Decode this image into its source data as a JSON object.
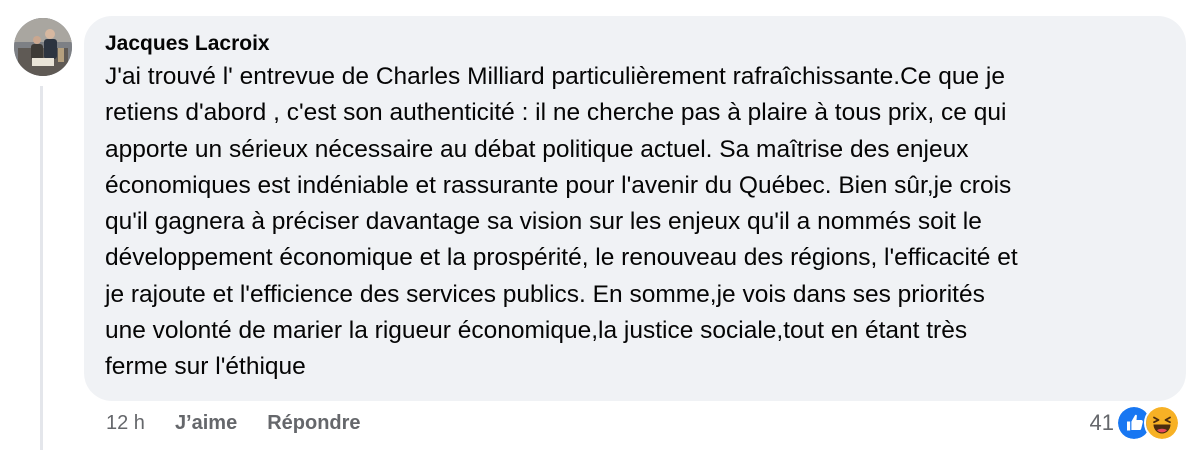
{
  "comment": {
    "author": "Jacques Lacroix",
    "text": "J'ai trouvé l' entrevue de Charles Milliard particulièrement rafraîchissante.Ce que je retiens d'abord , c'est son authenticité : il ne cherche pas à plaire à tous prix, ce qui apporte un sérieux nécessaire au débat politique actuel. Sa maîtrise des enjeux économiques est indéniable et rassurante pour l'avenir du Québec. Bien sûr,je crois qu'il gagnera à préciser davantage sa vision sur les enjeux qu'il a nommés soit le développement économique et la prospérité, le renouveau des régions, l'efficacité et je rajoute et l'efficience des services publics. En somme,je vois dans ses priorités une volonté de marier la rigueur économique,la justice sociale,tout en étant très ferme sur l'éthique",
    "text_lines": [
      "J'ai trouvé l' entrevue de Charles Milliard particulièrement rafraîchissante.Ce que je",
      "retiens d'abord , c'est son authenticité : il ne cherche pas à plaire à tous prix, ce qui",
      "apporte un sérieux nécessaire au débat politique actuel. Sa maîtrise des enjeux",
      "économiques est indéniable et rassurante pour l'avenir du Québec. Bien sûr,je crois",
      "qu'il gagnera à préciser davantage sa vision sur les enjeux qu'il a nommés soit le",
      "développement économique et la prospérité, le renouveau des régions, l'efficacité et",
      "je rajoute et l'efficience des services publics. En somme,je vois dans ses priorités",
      "une volonté de marier la rigueur économique,la justice sociale,tout en étant très",
      "ferme sur l'éthique"
    ]
  },
  "actions": {
    "time": "12 h",
    "like_label": "J’aime",
    "reply_label": "Répondre"
  },
  "reactions": {
    "count": "41",
    "icons": [
      "like-reaction-icon",
      "haha-reaction-icon"
    ]
  },
  "colors": {
    "bubble_bg": "#f0f2f5",
    "text_primary": "#050505",
    "text_secondary": "#65676b",
    "like_blue": "#1877f2",
    "haha_yellow": "#f7b125"
  }
}
